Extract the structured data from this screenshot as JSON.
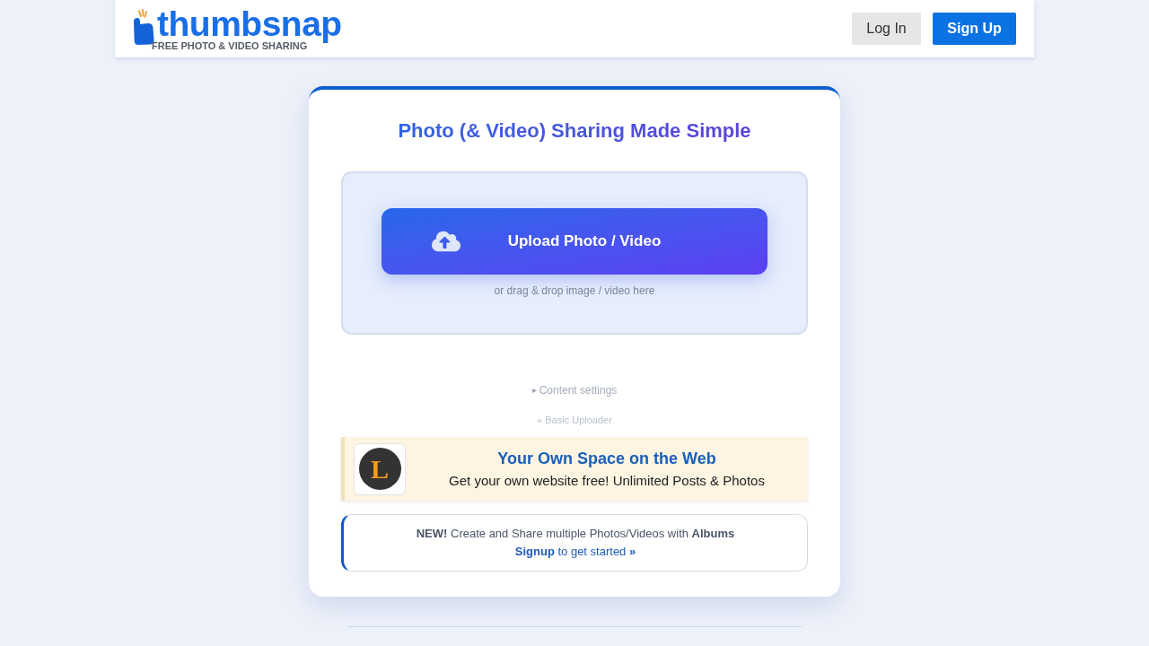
{
  "header": {
    "logo": {
      "name": "thumbsnap",
      "tagline": "FREE PHOTO & VIDEO SHARING"
    },
    "buttons": [
      {
        "label": "Log In",
        "kind": "secondary"
      },
      {
        "label": "Sign Up",
        "kind": "primary"
      }
    ]
  },
  "upload_card": {
    "title": "Photo (& Video) Sharing Made Simple",
    "upload_button": "Upload Photo / Video",
    "drop_hint": "or drag & drop image / video here",
    "content_settings": {
      "label": "Content settings",
      "expanded": false
    },
    "basic_uploader_link": "« Basic Uploader",
    "promo": {
      "logo_letter": "L",
      "title": "Your Own Space on the Web",
      "subtitle": "Get your own website free! Unlimited Posts & Photos"
    },
    "albums_notice": {
      "text": "**NEW!** Create and Share multiple Photos/Videos with **Albums**",
      "link": "**Signup** to get started **»**"
    }
  }
}
